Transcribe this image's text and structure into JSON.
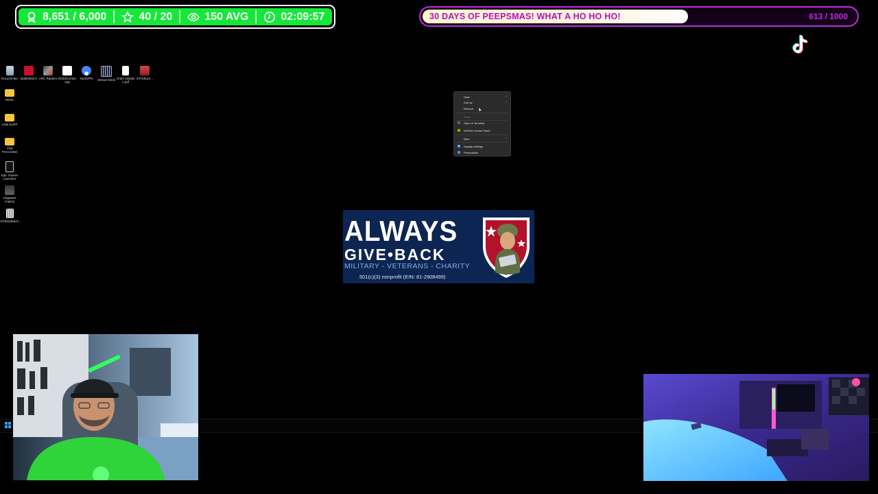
{
  "stats": {
    "followers": "8,651 / 6,000",
    "subs": "40 / 20",
    "viewers": "150 AVG",
    "uptime": "02:09:57"
  },
  "goal": {
    "title": "30 DAYS OF PEEPSMAS! WHAT A HO HO HO!",
    "count": "613 / 1000",
    "progress": 0.613
  },
  "desktop_icons": [
    {
      "label": "Recycle Bin"
    },
    {
      "label": "Battlefield 6"
    },
    {
      "label": "ARC Raiders"
    },
    {
      "label": "RODECenter App"
    },
    {
      "label": "NordVPN"
    },
    {
      "label": "Stream Deck"
    },
    {
      "label": "Order Details 1.pdf"
    },
    {
      "label": "GTHdSoX..."
    },
    {
      "label": "DESK"
    },
    {
      "label": "AGB SUPP"
    },
    {
      "label": "TTB TRACKING"
    },
    {
      "label": "Epic Games Launcher"
    },
    {
      "label": "Hogwarts Legacy"
    },
    {
      "label": "ATtrEdolbarG..."
    }
  ],
  "context_menu": {
    "view": "View",
    "sort_by": "Sort by",
    "refresh": "Refresh",
    "paste": "Paste",
    "open_terminal": "Open in Terminal",
    "nvidia": "NVIDIA Control Panel",
    "new": "New",
    "display_settings": "Display settings",
    "personalize": "Personalize"
  },
  "charity": {
    "line1": "ALWAYS",
    "line2": "GIVE•BACK",
    "line3": "MILITARY - VETERANS - CHARITY",
    "line4": "501(c)(3) nonprofit (EIN: 81-2908499)"
  },
  "colors": {
    "stats_green": "#16e83a",
    "goal_purple": "#c02de0",
    "charity_navy": "#0d2552"
  }
}
